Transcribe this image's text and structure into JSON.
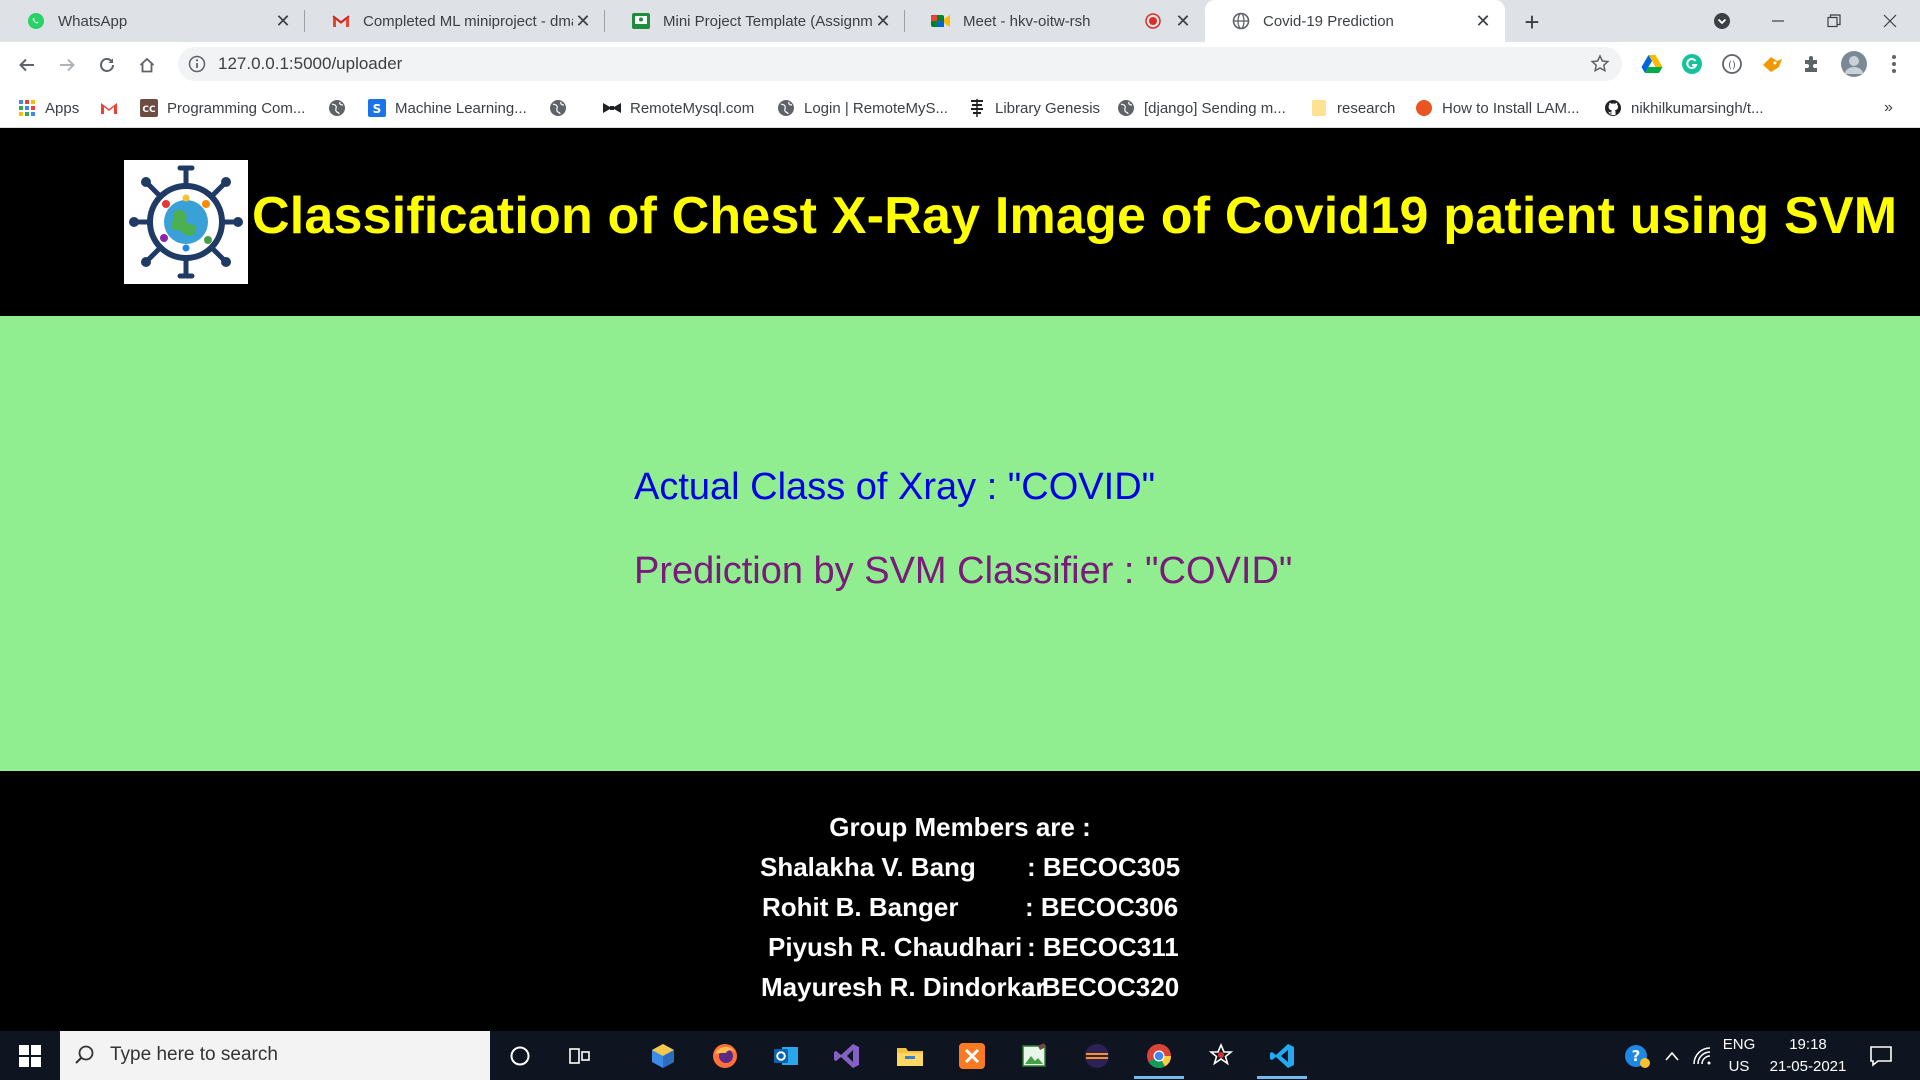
{
  "browser": {
    "tabs": [
      {
        "title": "WhatsApp",
        "icon": "whatsapp-icon"
      },
      {
        "title": "Completed ML miniproject - dma",
        "icon": "gmail-icon"
      },
      {
        "title": "Mini Project Template (Assignme",
        "icon": "classroom-icon"
      },
      {
        "title": "Meet - hkv-oitw-rsh",
        "icon": "meet-icon"
      },
      {
        "title": "Covid-19 Prediction",
        "icon": "globe-icon",
        "active": true
      }
    ],
    "url": "127.0.0.1:5000/uploader",
    "bookmarks": [
      {
        "label": "Apps",
        "icon": "apps-grid-icon"
      },
      {
        "label": "",
        "icon": "gmail-icon"
      },
      {
        "label": "Programming Com...",
        "icon": "cc-icon"
      },
      {
        "label": "",
        "icon": "globe-icon"
      },
      {
        "label": "Machine Learning...",
        "icon": "s-icon"
      },
      {
        "label": "",
        "icon": "globe-icon"
      },
      {
        "label": "RemoteMysql.com",
        "icon": "bowtie-icon"
      },
      {
        "label": "Login | RemoteMyS...",
        "icon": "globe-icon"
      },
      {
        "label": "Library Genesis",
        "icon": "libgen-icon"
      },
      {
        "label": "[django] Sending m...",
        "icon": "globe-icon"
      },
      {
        "label": "research",
        "icon": "folder-icon"
      },
      {
        "label": "How to Install LAM...",
        "icon": "ubuntu-icon"
      },
      {
        "label": "nikhilkumarsingh/t...",
        "icon": "github-icon"
      }
    ],
    "more_bookmarks": "»"
  },
  "page": {
    "title": "Classification of Chest X-Ray Image of Covid19 patient using SVM",
    "actual": "Actual Class of Xray : \"COVID\"",
    "prediction": "Prediction by SVM Classifier : \"COVID\"",
    "members_heading": "Group Members are :",
    "members": [
      {
        "name": "Shalakha V. Bang",
        "id": ": BECOC305"
      },
      {
        "name": "Rohit B. Banger",
        "id": ": BECOC306"
      },
      {
        "name": "Piyush R. Chaudhari",
        "id": ": BECOC311"
      },
      {
        "name": "Mayuresh R. Dindorkar",
        "id": ": BECOC320"
      }
    ],
    "colors": {
      "header_bg": "#000000",
      "title": "#ffff00",
      "panel_bg": "#90ee90",
      "actual_text": "#0000e6",
      "prediction_text": "#7a1a7a",
      "footer_text": "#ffffff"
    }
  },
  "taskbar": {
    "search_placeholder": "Type here to search",
    "lang": "ENG",
    "region": "US",
    "time": "19:18",
    "date": "21-05-2021"
  }
}
